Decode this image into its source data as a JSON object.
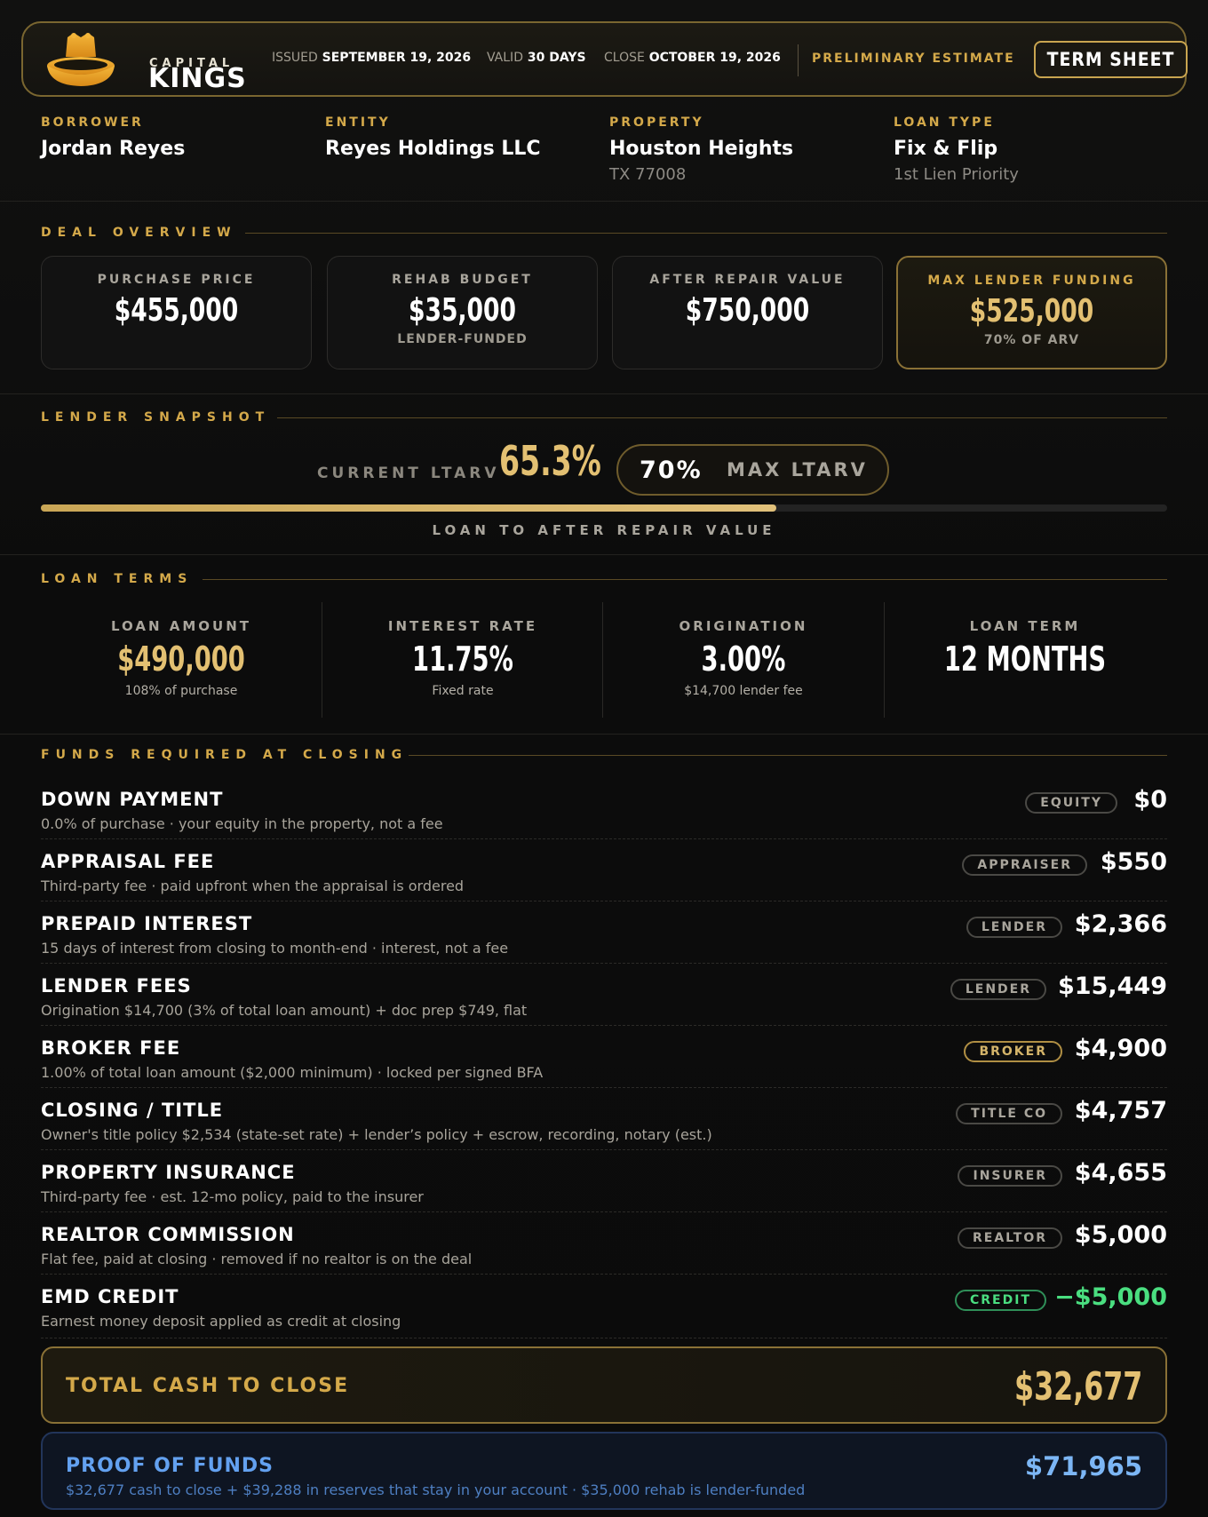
{
  "header": {
    "brand_top": "CAPITAL",
    "brand_bottom": "KINGS",
    "issued_label": "ISSUED",
    "issued_value": "SEPTEMBER 19, 2026",
    "valid_label": "VALID",
    "valid_value": "30 DAYS",
    "close_label": "CLOSE",
    "close_value": "OCTOBER 19, 2026",
    "status": "PRELIMINARY ESTIMATE",
    "term_sheet_button": "TERM SHEET"
  },
  "info": [
    {
      "label": "BORROWER",
      "value": "Jordan Reyes",
      "sub": ""
    },
    {
      "label": "ENTITY",
      "value": "Reyes Holdings LLC",
      "sub": ""
    },
    {
      "label": "PROPERTY",
      "value": "Houston Heights",
      "sub": "TX 77008"
    },
    {
      "label": "LOAN TYPE",
      "value": "Fix & Flip",
      "sub": "1st Lien Priority"
    }
  ],
  "deal_overview": {
    "title": "DEAL OVERVIEW",
    "cards": [
      {
        "label": "PURCHASE PRICE",
        "value": "$455,000",
        "sub": ""
      },
      {
        "label": "REHAB BUDGET",
        "value": "$35,000",
        "sub": "LENDER-FUNDED"
      },
      {
        "label": "AFTER REPAIR VALUE",
        "value": "$750,000",
        "sub": ""
      },
      {
        "label": "MAX LENDER FUNDING",
        "value": "$525,000",
        "sub": "70% OF ARV"
      }
    ]
  },
  "snapshot": {
    "title": "LENDER SNAPSHOT",
    "current_label": "CURRENT LTARV",
    "current_value": "65.3%",
    "current_fraction": 0.653,
    "max_value": "70%",
    "max_label": "MAX LTARV",
    "caption": "LOAN TO AFTER REPAIR VALUE"
  },
  "loan_terms": {
    "title": "LOAN TERMS",
    "items": [
      {
        "label": "LOAN AMOUNT",
        "value": "$490,000",
        "sub": "108% of purchase"
      },
      {
        "label": "INTEREST RATE",
        "value": "11.75%",
        "sub": "Fixed rate"
      },
      {
        "label": "ORIGINATION",
        "value": "3.00%",
        "sub": "$14,700 lender fee"
      },
      {
        "label": "LOAN TERM",
        "value": "12 MONTHS",
        "sub": ""
      }
    ]
  },
  "funds": {
    "title": "FUNDS REQUIRED AT CLOSING",
    "rows": [
      {
        "title": "DOWN PAYMENT",
        "desc": "0.0% of purchase · your equity in the property, not a fee",
        "tag": "EQUITY",
        "amount": "$0"
      },
      {
        "title": "APPRAISAL FEE",
        "desc": "Third-party fee · paid upfront when the appraisal is ordered",
        "tag": "APPRAISER",
        "amount": "$550"
      },
      {
        "title": "PREPAID INTEREST",
        "desc": "15 days of interest from closing to month-end · interest, not a fee",
        "tag": "LENDER",
        "amount": "$2,366"
      },
      {
        "title": "LENDER FEES",
        "desc": "Origination $14,700 (3% of total loan amount) + doc prep $749, flat",
        "tag": "LENDER",
        "amount": "$15,449"
      },
      {
        "title": "BROKER FEE",
        "desc": "1.00% of total loan amount ($2,000 minimum) · locked per signed BFA",
        "tag": "BROKER",
        "amount": "$4,900"
      },
      {
        "title": "CLOSING / TITLE",
        "desc": "Owner's title policy $2,534 (state-set rate) + lender’s policy + escrow, recording, notary (est.)",
        "tag": "TITLE CO",
        "amount": "$4,757"
      },
      {
        "title": "PROPERTY INSURANCE",
        "desc": "Third-party fee · est. 12-mo policy, paid to the insurer",
        "tag": "INSURER",
        "amount": "$4,655"
      },
      {
        "title": "REALTOR COMMISSION",
        "desc": "Flat fee, paid at closing · removed if no realtor is on the deal",
        "tag": "REALTOR",
        "amount": "$5,000"
      },
      {
        "title": "EMD CREDIT",
        "desc": "Earnest money deposit applied as credit at closing",
        "tag": "CREDIT",
        "amount": "−$5,000"
      }
    ]
  },
  "total": {
    "label": "TOTAL CASH TO CLOSE",
    "amount": "$32,677"
  },
  "proof_of_funds": {
    "label": "PROOF OF FUNDS",
    "desc": "$32,677 cash to close + $39,288 in reserves that stay in your account · $35,000 rehab is lender-funded",
    "amount": "$71,965"
  },
  "colors": {
    "gold": "#d4a94a",
    "gold_value": "#e3c072",
    "green": "#4ade80",
    "blue": "#63a1f0"
  }
}
